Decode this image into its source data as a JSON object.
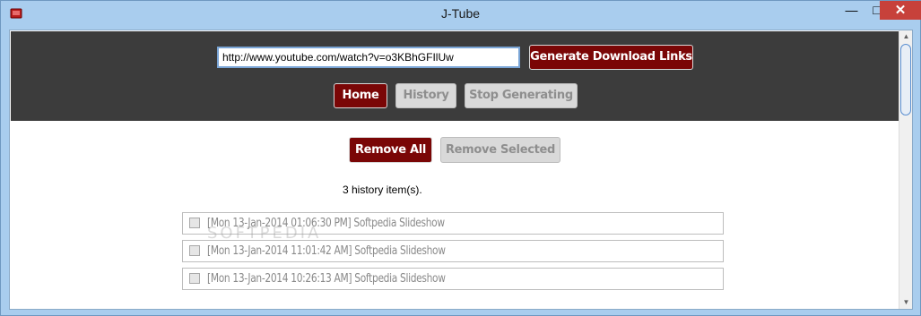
{
  "window": {
    "title": "J-Tube",
    "minimize_glyph": "—",
    "maximize_glyph": "□",
    "close_glyph": "✕",
    "icon": "app-icon"
  },
  "header": {
    "url_value": "http://www.youtube.com/watch?v=o3KBhGFIlUw",
    "generate_label": "Generate Download Links",
    "nav": {
      "home_label": "Home",
      "history_label": "History",
      "stop_label": "Stop Generating"
    }
  },
  "history": {
    "remove_all_label": "Remove All",
    "remove_selected_label": "Remove Selected",
    "count_text": "3 history item(s).",
    "items": [
      {
        "label": "[Mon 13-Jan-2014 01:06:30 PM] Softpedia Slideshow",
        "checked": false
      },
      {
        "label": "[Mon 13-Jan-2014 11:01:42 AM] Softpedia Slideshow",
        "checked": false
      },
      {
        "label": "[Mon 13-Jan-2014 10:26:13 AM] Softpedia Slideshow",
        "checked": false
      }
    ]
  },
  "scrollbar": {
    "up_glyph": "▲",
    "down_glyph": "▼"
  },
  "watermark": "SOFTPEDIA",
  "colors": {
    "accent_red": "#7a0606",
    "header_bg": "#3c3c3c",
    "window_frame": "#a9cdee",
    "close_button": "#c7413b"
  }
}
